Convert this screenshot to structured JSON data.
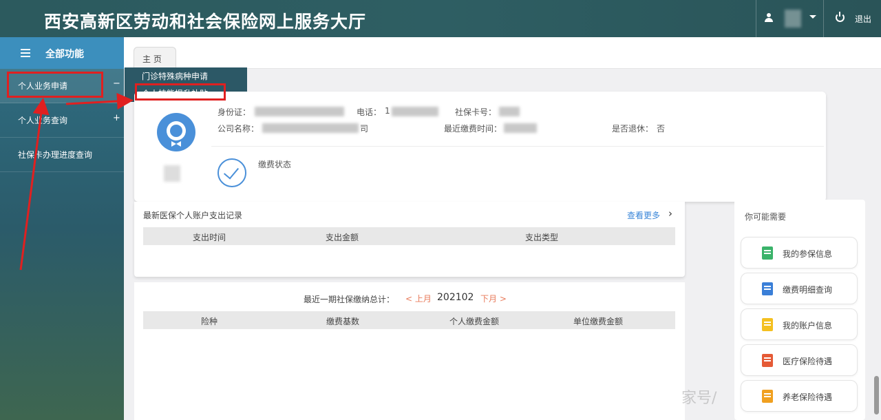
{
  "header": {
    "title": "西安高新区劳动和社会保险网上服务大厅",
    "logout_label": "退出"
  },
  "sidebar": {
    "title": "全部功能",
    "items": [
      {
        "label": "个人业务申请",
        "symbol": "−"
      },
      {
        "label": "个人业务查询",
        "symbol": "+"
      },
      {
        "label": "社保卡办理进度查询",
        "symbol": ""
      }
    ]
  },
  "submenu": {
    "items": [
      {
        "label": "门诊特殊病种申请"
      },
      {
        "label": "个人技能提升补贴"
      }
    ]
  },
  "tabs": [
    {
      "label": "主 页"
    }
  ],
  "profile": {
    "id_label": "身份证：",
    "phone_label": "电话：",
    "phone_value": "1",
    "card_label": "社保卡号：",
    "company_label": "公司名称：",
    "company_suffix": "司",
    "recent_label": "最近缴费时间：",
    "retired_label": "是否退休：",
    "retired_value": "否",
    "status_label": "缴费状态"
  },
  "records": {
    "title": "最新医保个人账户支出记录",
    "more_label": "查看更多",
    "columns": [
      "支出时间",
      "支出金额",
      "支出类型"
    ]
  },
  "monthly": {
    "label": "最近一期社保缴纳总计：",
    "prev_label": "< 上月",
    "value": "202102",
    "next_label": "下月 >",
    "columns": [
      "险种",
      "缴费基数",
      "个人缴费金额",
      "单位缴费金额"
    ]
  },
  "quick": {
    "title": "你可能需要",
    "items": [
      {
        "label": "我的参保信息",
        "icon": "document-icon",
        "color": "#3ab36a"
      },
      {
        "label": "缴费明细查询",
        "icon": "receipt-icon",
        "color": "#3a7fd8"
      },
      {
        "label": "我的账户信息",
        "icon": "account-icon",
        "color": "#f4c020"
      },
      {
        "label": "医疗保险待遇",
        "icon": "medical-kit-icon",
        "color": "#e55a36"
      },
      {
        "label": "养老保险待遇",
        "icon": "pension-icon",
        "color": "#f0a020"
      }
    ]
  },
  "watermark": "家号/"
}
